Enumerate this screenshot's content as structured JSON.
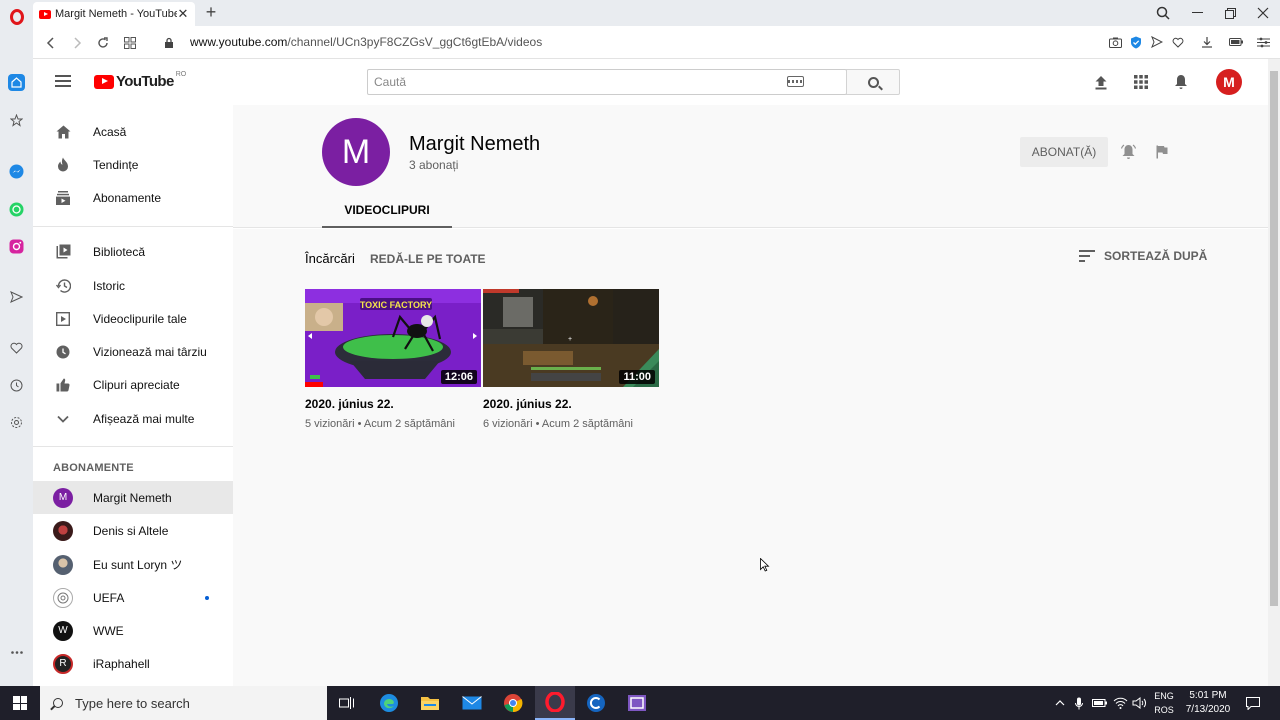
{
  "browser": {
    "tab_title": "Margit Nemeth - YouTube",
    "url_host": "www.youtube.com",
    "url_path": "/channel/UCn3pyF8CZGsV_ggCt6gtEbA/videos"
  },
  "youtube": {
    "logo_text": "YouTube",
    "country_code": "RO",
    "search_placeholder": "Caută",
    "profile_initial": "M"
  },
  "sidebar": {
    "main_items": [
      {
        "label": "Acasă",
        "icon": "home-icon"
      },
      {
        "label": "Tendințe",
        "icon": "trending-icon"
      },
      {
        "label": "Abonamente",
        "icon": "subscriptions-icon"
      }
    ],
    "library_items": [
      {
        "label": "Bibliotecă",
        "icon": "library-icon"
      },
      {
        "label": "Istoric",
        "icon": "history-icon"
      },
      {
        "label": "Videoclipurile tale",
        "icon": "your-videos-icon"
      },
      {
        "label": "Vizionează mai târziu",
        "icon": "watch-later-icon"
      },
      {
        "label": "Clipuri apreciate",
        "icon": "liked-icon"
      },
      {
        "label": "Afișează mai multe",
        "icon": "chevron-down-icon"
      }
    ],
    "subscriptions_heading": "ABONAMENTE",
    "subscriptions": [
      {
        "label": "Margit Nemeth",
        "initial": "M",
        "color": "#7b1fa2",
        "active": true
      },
      {
        "label": "Denis si Altele",
        "initial": "",
        "color": "#5a2a2a"
      },
      {
        "label": "Eu sunt Loryn ツ",
        "initial": "",
        "color": "#6b7a8a"
      },
      {
        "label": "UEFA",
        "initial": "",
        "color": "#e6e6e6",
        "new": true
      },
      {
        "label": "WWE",
        "initial": "W",
        "color": "#111111"
      },
      {
        "label": "iRaphahell",
        "initial": "R",
        "color": "#222222"
      }
    ]
  },
  "channel": {
    "avatar_initial": "M",
    "name": "Margit Nemeth",
    "subscribers": "3 abonați",
    "subscribe_label": "ABONAT(Ă)",
    "tab_label": "VIDEOCLIPURI"
  },
  "uploads": {
    "section_title": "Încărcări",
    "play_all": "REDĂ-LE PE TOATE",
    "sort_label": "SORTEAZĂ DUPĂ",
    "videos": [
      {
        "title": "2020. június 22.",
        "duration": "12:06",
        "views": "5 vizionări",
        "age": "Acum 2 săptămâni",
        "thumb_text": "TOXIC FACTORY"
      },
      {
        "title": "2020. június 22.",
        "duration": "11:00",
        "views": "6 vizionări",
        "age": "Acum 2 săptămâni",
        "thumb_text": ""
      }
    ]
  },
  "taskbar": {
    "search_placeholder": "Type here to search",
    "lang_top": "ENG",
    "lang_bottom": "ROS",
    "time": "5:01 PM",
    "date": "7/13/2020"
  },
  "colors": {
    "youtube_red": "#ff0000",
    "channel_avatar": "#7b1fa2",
    "opera_red": "#e0161b",
    "taskbar": "#1f1f2a"
  }
}
